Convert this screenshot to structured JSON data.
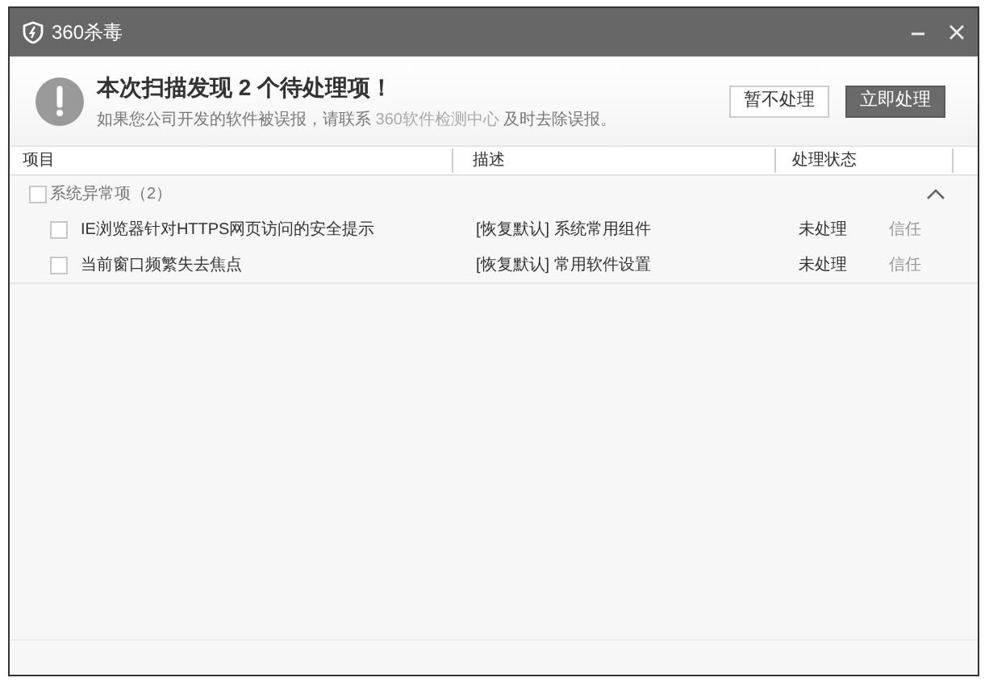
{
  "window": {
    "title": "360杀毒"
  },
  "header": {
    "title": "本次扫描发现 2 个待处理项！",
    "note_before": "如果您公司开发的软件被误报，请联系 ",
    "note_link": "360软件检测中心",
    "note_after": " 及时去除误报。",
    "buttons": [
      {
        "label": "暂不处理",
        "kind": "secondary"
      },
      {
        "label": "立即处理",
        "kind": "primary"
      }
    ]
  },
  "table": {
    "columns": [
      "项目",
      "描述",
      "处理状态"
    ],
    "groups": [
      {
        "label": "系统异常项（2）",
        "checked": false,
        "expanded": true,
        "rows": [
          {
            "item": "IE浏览器针对HTTPS网页访问的安全提示",
            "description": "[恢复默认] 系统常用组件",
            "status": "未处理",
            "action": "信任",
            "checked": false
          },
          {
            "item": "当前窗口频繁失去焦点",
            "description": "[恢复默认] 常用软件设置",
            "status": "未处理",
            "action": "信任",
            "checked": false
          }
        ]
      }
    ]
  }
}
